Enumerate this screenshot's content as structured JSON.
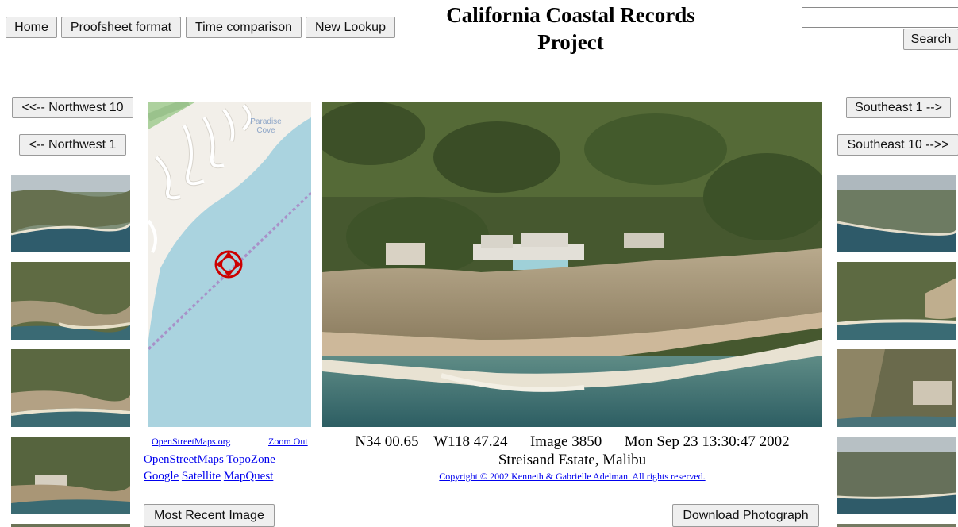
{
  "nav": {
    "home": "Home",
    "proofsheet": "Proofsheet format",
    "time_comparison": "Time comparison",
    "new_lookup": "New Lookup"
  },
  "title": "California Coastal Records Project",
  "search": {
    "button": "Search",
    "value": ""
  },
  "navigation": {
    "nw10": "<<-- Northwest 10",
    "nw1": "<-- Northwest 1",
    "se1": "Southeast 1 -->",
    "se10": "Southeast 10 -->>"
  },
  "map": {
    "place_label_line1": "Paradise",
    "place_label_line2": "Cove",
    "credit": "OpenStreetMaps.org",
    "zoom_out": "Zoom Out",
    "links": {
      "openstreetmaps": "OpenStreetMaps",
      "topozone": "TopoZone",
      "google": "Google",
      "satellite": "Satellite",
      "mapquest": "MapQuest"
    },
    "colors": {
      "water": "#aad3df",
      "land": "#f2efe9",
      "road": "#ffffff",
      "green": "#add19e",
      "track": "#a891c8",
      "marker": "#cc0000"
    }
  },
  "photo": {
    "latitude": "N34 00.65",
    "longitude": "W118 47.24",
    "image_number": "Image 3850",
    "date": "Mon Sep 23 13:30:47 2002",
    "location": "Streisand Estate, Malibu",
    "copyright": "Copyright © 2002 Kenneth & Gabrielle Adelman. All rights reserved."
  },
  "buttons": {
    "most_recent": "Most Recent Image",
    "download": "Download Photograph"
  }
}
